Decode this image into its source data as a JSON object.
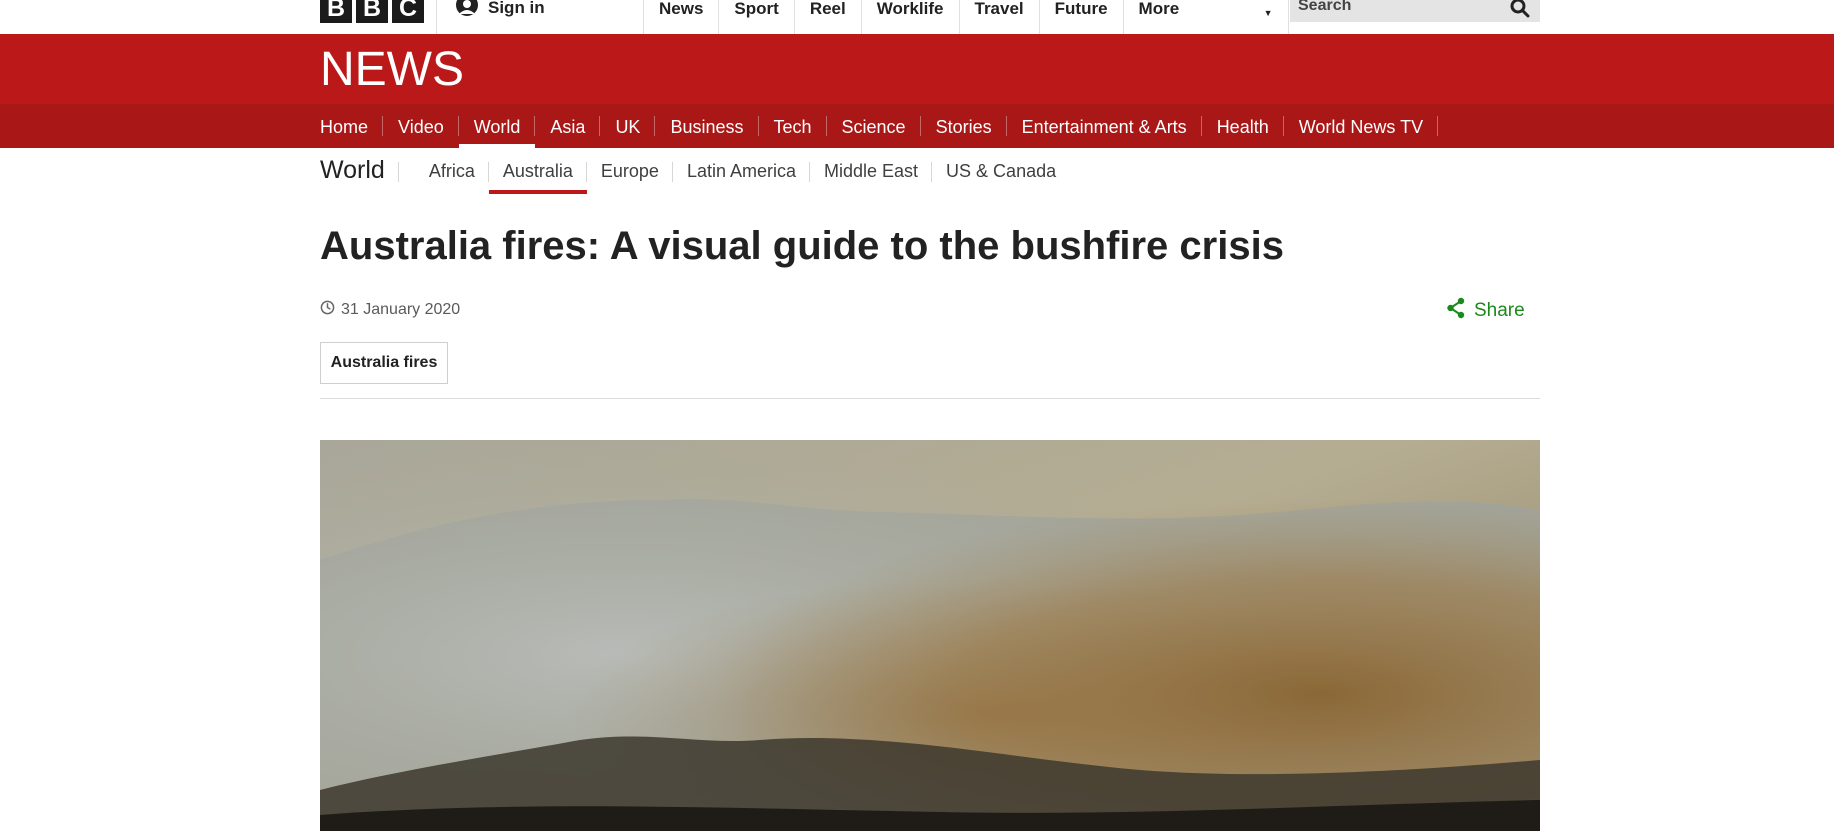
{
  "masthead": {
    "logo_letters": [
      "B",
      "B",
      "C"
    ],
    "sign_in_label": "Sign in",
    "nav_items": [
      "News",
      "Sport",
      "Reel",
      "Worklife",
      "Travel",
      "Future"
    ],
    "more_label": "More",
    "search_placeholder": "Search"
  },
  "news_band": {
    "wordmark": "NEWS",
    "brand_color": "#bb1919"
  },
  "primary_nav": {
    "items": [
      "Home",
      "Video",
      "World",
      "Asia",
      "UK",
      "Business",
      "Tech",
      "Science",
      "Stories",
      "Entertainment & Arts",
      "Health",
      "World News TV"
    ],
    "active": "World"
  },
  "secondary_nav": {
    "title": "World",
    "items": [
      "Africa",
      "Australia",
      "Europe",
      "Latin America",
      "Middle East",
      "US & Canada"
    ],
    "active": "Australia"
  },
  "article": {
    "headline": "Australia fires: A visual guide to the bushfire crisis",
    "date": "31 January 2020",
    "share_label": "Share",
    "tag": "Australia fires",
    "share_color": "#1b8a1b"
  },
  "icons": {
    "avatar": "user-avatar-icon",
    "search": "search-icon",
    "clock": "clock-icon",
    "share": "share-icon",
    "caret": "caret-down-icon"
  }
}
